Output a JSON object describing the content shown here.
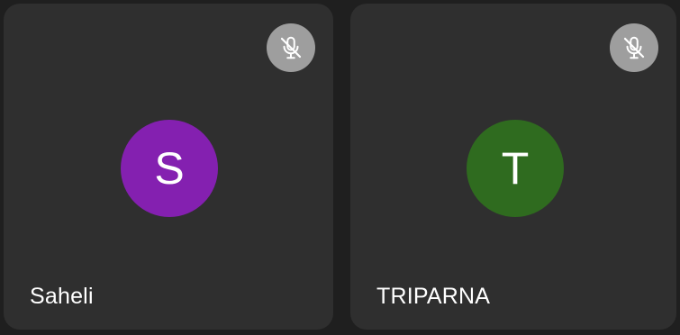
{
  "participants": [
    {
      "name": "Saheli",
      "initial": "S",
      "avatar_color": "#8420b0",
      "muted": true,
      "mute_icon": "mic-off-icon"
    },
    {
      "name": "TRIPARNA",
      "initial": "T",
      "avatar_color": "#2f6b1f",
      "muted": true,
      "mute_icon": "mic-off-icon"
    }
  ],
  "colors": {
    "background": "#1f1f1f",
    "tile": "#2f2f2f",
    "mute_badge": "#9e9e9e",
    "text": "#ffffff"
  }
}
